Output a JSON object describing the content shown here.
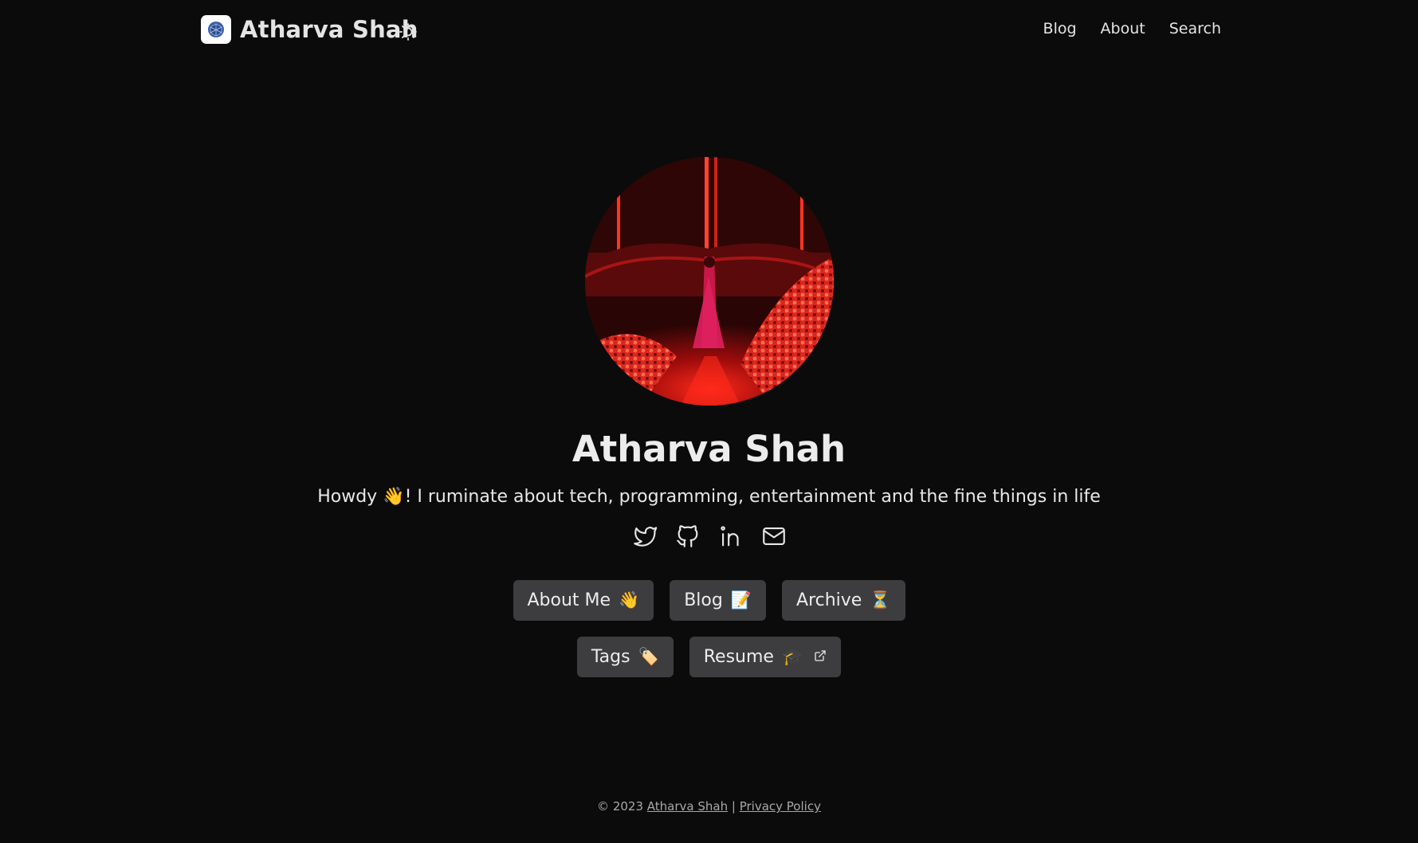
{
  "header": {
    "brand_name": "Atharva Shah",
    "nav": [
      {
        "label": "Blog"
      },
      {
        "label": "About"
      },
      {
        "label": "Search"
      }
    ]
  },
  "hero": {
    "name": "Atharva Shah",
    "tagline_before": "Howdy ",
    "tagline_emoji": "👋",
    "tagline_after": "! I ruminate about tech, programming, entertainment and the fine things in life",
    "socials": [
      "twitter-icon",
      "github-icon",
      "linkedin-icon",
      "mail-icon"
    ],
    "buttons_row1": [
      {
        "label": "About Me",
        "emoji": "👋"
      },
      {
        "label": "Blog",
        "emoji": "📝"
      },
      {
        "label": "Archive",
        "emoji": "⏳"
      }
    ],
    "buttons_row2": [
      {
        "label": "Tags",
        "emoji": "🏷️"
      },
      {
        "label": "Resume",
        "emoji": "🎓"
      }
    ]
  },
  "footer": {
    "copyright": "© 2023",
    "author_link": "Atharva Shah",
    "separator": "|",
    "privacy_link": "Privacy Policy"
  },
  "colors": {
    "background": "#0b0b0b",
    "text": "#e4e4e4",
    "button_bg": "#3d3d3f",
    "footer_text": "#a8a8a8"
  }
}
